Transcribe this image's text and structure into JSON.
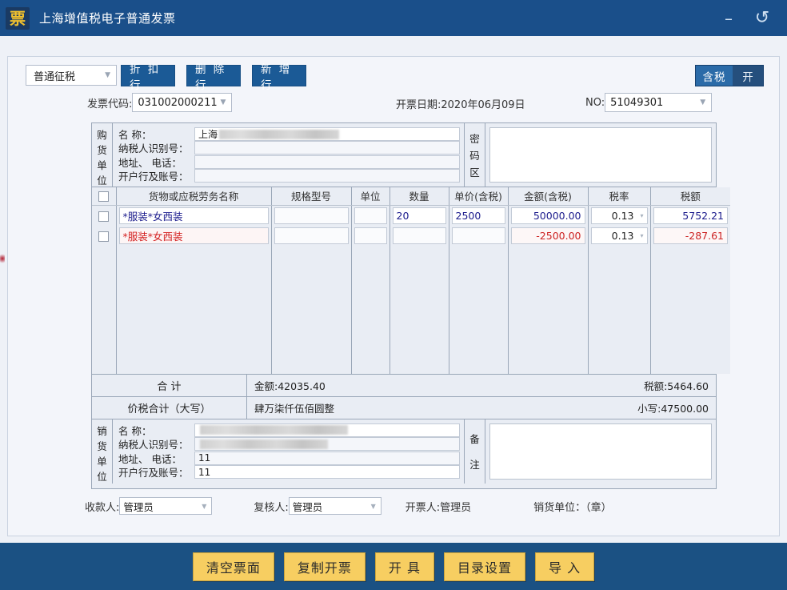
{
  "window": {
    "title": "上海增值税电子普通发票",
    "logo_glyph": "票",
    "minimize_glyph": "–",
    "restore_glyph": "↺"
  },
  "toolbar": {
    "tax_mode": "普通征税",
    "caret": "▼",
    "discount_row": "折 扣 行",
    "delete_row": "删 除 行",
    "add_row": "新 增 行",
    "tax_included_on": "含税",
    "tax_included_off": "开"
  },
  "invoice_header": {
    "code_label": "发票代码:",
    "code_value": "031002000211",
    "date_text": "开票日期:2020年06月09日",
    "no_label": "NO:",
    "no_value": "51049301"
  },
  "buyer": {
    "tag": "购货单位",
    "tag_chars": [
      "购",
      "货",
      "单",
      "位"
    ],
    "labels": {
      "name": "名        称：",
      "taxid": "纳税人识别号：",
      "addr": "地址、  电话：",
      "bank": "开户行及账号："
    },
    "name_value": "上海",
    "name_redacted": true,
    "taxid_value": "",
    "addr_value": "",
    "bank_value": "",
    "side_tag_chars": [
      "密",
      "码",
      "区"
    ],
    "side_tag": "密码区"
  },
  "items": {
    "columns": [
      "货物或应税劳务名称",
      "规格型号",
      "单位",
      "数量",
      "单价(含税)",
      "金额(含税)",
      "税率",
      "税额"
    ],
    "rows": [
      {
        "checked": false,
        "name": "*服装*女西装",
        "spec": "",
        "unit": "",
        "qty": "20",
        "price": "2500",
        "amount": "50000.00",
        "rate": "0.13",
        "tax": "5752.21",
        "negative": false
      },
      {
        "checked": false,
        "name": "*服装*女西装",
        "spec": "",
        "unit": "",
        "qty": "",
        "price": "",
        "amount": "-2500.00",
        "rate": "0.13",
        "tax": "-287.61",
        "negative": true
      }
    ]
  },
  "totals": {
    "sum_label": "合    计",
    "sum_amount": "金额:42035.40",
    "sum_tax": "税额:5464.60",
    "grand_label": "价税合计（大写）",
    "grand_words": "肆万柒仟伍佰圆整",
    "grand_digits": "小写:47500.00"
  },
  "seller": {
    "tag": "销货单位",
    "tag_chars": [
      "销",
      "货",
      "单",
      "位"
    ],
    "labels": {
      "name": "名        称：",
      "taxid": "纳税人识别号：",
      "addr": "地址、  电话：",
      "bank": "开户行及账号："
    },
    "name_value": "",
    "name_redacted": true,
    "taxid_value": "",
    "taxid_redacted": true,
    "addr_value": "11",
    "bank_value": "11",
    "side_tag_chars": [
      "备",
      "注"
    ],
    "side_tag": "备注"
  },
  "persons": {
    "payee_label": "收款人:",
    "payee_value": "管理员",
    "reviewer_label": "复核人:",
    "reviewer_value": "管理员",
    "drawer_text": "开票人:管理员",
    "seller_unit_text": "销货单位：（章）",
    "caret": "▼"
  },
  "actions": [
    {
      "label": "清空票面"
    },
    {
      "label": "复制开票"
    },
    {
      "label": "开  具"
    },
    {
      "label": "目录设置"
    },
    {
      "label": "导  入"
    }
  ],
  "colors": {
    "titlebar": "#1a4f8a",
    "bottombar": "#1b5183",
    "accent_button": "#f7ce61",
    "toolbar_button": "#1b5a96",
    "value_text": "#1a1a8c",
    "negative_text": "#cc2222",
    "logo_gold": "#f2c12e"
  }
}
